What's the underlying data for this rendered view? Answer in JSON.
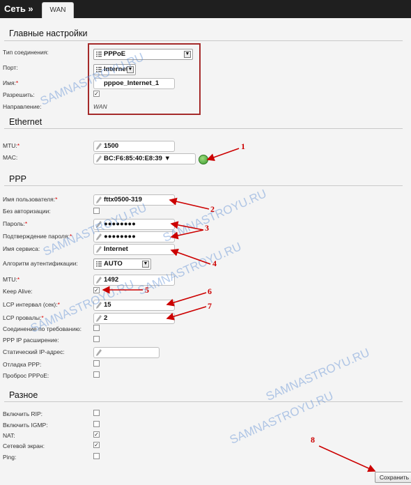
{
  "header": {
    "title": "Сеть »",
    "tab": "WAN"
  },
  "main_settings": {
    "title": "Главные настройки",
    "connection_type_label": "Тип соединения:",
    "connection_type_value": "PPPoE",
    "port_label": "Порт:",
    "port_value": "Internet",
    "name_label": "Имя:",
    "name_value": "pppoe_Internet_1",
    "enable_label": "Разрешить:",
    "enable_checked": true,
    "direction_label": "Направление:",
    "direction_value": "WAN"
  },
  "ethernet": {
    "title": "Ethernet",
    "mtu_label": "MTU:",
    "mtu_value": "1500",
    "mac_label": "MAC:",
    "mac_value": "BC:F6:85:40:E8:39"
  },
  "ppp": {
    "title": "PPP",
    "username_label": "Имя пользователя:",
    "username_value": "fttx0500-319",
    "no_auth_label": "Без авторизации:",
    "no_auth_checked": false,
    "password_label": "Пароль:",
    "password_value": "●●●●●●●●",
    "password_confirm_label": "Подтверждение пароля:",
    "password_confirm_value": "●●●●●●●●",
    "service_label": "Имя сервиса:",
    "service_value": "Internet",
    "auth_algo_label": "Алгоритм аутентификации:",
    "auth_algo_value": "AUTO",
    "mtu_label": "MTU:",
    "mtu_value": "1492",
    "keepalive_label": "Keep Alive:",
    "keepalive_checked": true,
    "lcp_interval_label": "LCP интервал (сек):",
    "lcp_interval_value": "15",
    "lcp_fails_label": "LCP провалы:",
    "lcp_fails_value": "2",
    "on_demand_label": "Соединение по требованию:",
    "on_demand_checked": false,
    "ip_ext_label": "PPP IP расширение:",
    "ip_ext_checked": false,
    "static_ip_label": "Статический IP-адрес:",
    "static_ip_value": "",
    "debug_label": "Отладка PPP:",
    "debug_checked": false,
    "passthrough_label": "Проброс PPPoE:",
    "passthrough_checked": false
  },
  "misc": {
    "title": "Разное",
    "rip_label": "Включить RIP:",
    "rip_checked": false,
    "igmp_label": "Включить IGMP:",
    "igmp_checked": false,
    "nat_label": "NAT:",
    "nat_checked": true,
    "firewall_label": "Сетевой экран:",
    "firewall_checked": true,
    "ping_label": "Ping:",
    "ping_checked": false
  },
  "save_label": "Сохранить",
  "watermark": "SAMNASTROYU.RU",
  "annotations": [
    "1",
    "2",
    "3",
    "4",
    "5",
    "6",
    "7",
    "8"
  ],
  "colors": {
    "topbar": "#1f1f1f",
    "annotation": "#cc0000",
    "required": "#dd0000",
    "watermark": "#5a8cd2"
  },
  "icons": {
    "pencil": "pencil-icon",
    "list": "list-icon",
    "refresh": "refresh-icon",
    "check": "checkmark-icon"
  }
}
